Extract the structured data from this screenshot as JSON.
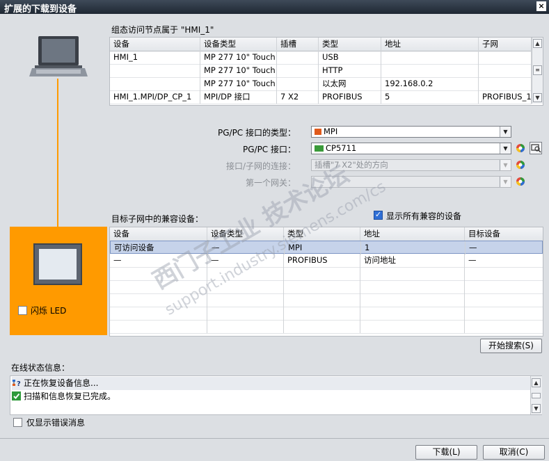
{
  "window": {
    "title": "扩展的下载到设备",
    "close_label": "×"
  },
  "device_table": {
    "caption": "组态访问节点属于 \"HMI_1\"",
    "headers": [
      "设备",
      "设备类型",
      "插槽",
      "类型",
      "地址",
      "子网"
    ],
    "rows": [
      [
        "HMI_1",
        "MP 277 10\" Touch",
        "",
        "USB",
        "",
        ""
      ],
      [
        "",
        "MP 277 10\" Touch",
        "",
        "HTTP",
        "",
        ""
      ],
      [
        "",
        "MP 277 10\" Touch",
        "",
        "以太网",
        "192.168.0.2",
        ""
      ],
      [
        "HMI_1.MPI/DP_CP_1",
        "MPI/DP 接口",
        "7 X2",
        "PROFIBUS",
        "5",
        "PROFIBUS_1"
      ]
    ]
  },
  "form": {
    "iface_type_label": "PG/PC 接口的类型：",
    "iface_type_value": "MPI",
    "iface_label": "PG/PC 接口：",
    "iface_value": "CP5711",
    "conn_label": "接口/子网的连接：",
    "conn_value": "插槽\"7 X2\"处的方向",
    "gateway_label": "第一个网关：",
    "gateway_value": ""
  },
  "compat": {
    "caption": "目标子网中的兼容设备：",
    "show_all_label": "显示所有兼容的设备",
    "show_all_checked": true,
    "headers": [
      "设备",
      "设备类型",
      "类型",
      "地址",
      "目标设备"
    ],
    "rows": [
      [
        "可访问设备",
        "—",
        "MPI",
        "1",
        "—"
      ],
      [
        "—",
        "—",
        "PROFIBUS",
        "访问地址",
        "—"
      ]
    ]
  },
  "device_panel": {
    "flash_led_label": "闪烁 LED"
  },
  "search_button": "开始搜索(S)",
  "online_status": {
    "caption": "在线状态信息：",
    "lines": [
      {
        "icon": "network-question-icon",
        "text": "正在恢复设备信息..."
      },
      {
        "icon": "green-check-icon",
        "text": "扫描和信息恢复已完成。"
      }
    ],
    "errors_only_label": "仅显示错误消息"
  },
  "footer": {
    "download_label": "下载(L)",
    "cancel_label": "取消(C)"
  },
  "watermark": {
    "line1": "西门子工业 技术论坛",
    "line2": "support.industry.siemens.com/cs"
  },
  "colors": {
    "accent_orange": "#ff9a00",
    "title_dark": "#1f2833",
    "selection": "#c6d3ea"
  }
}
